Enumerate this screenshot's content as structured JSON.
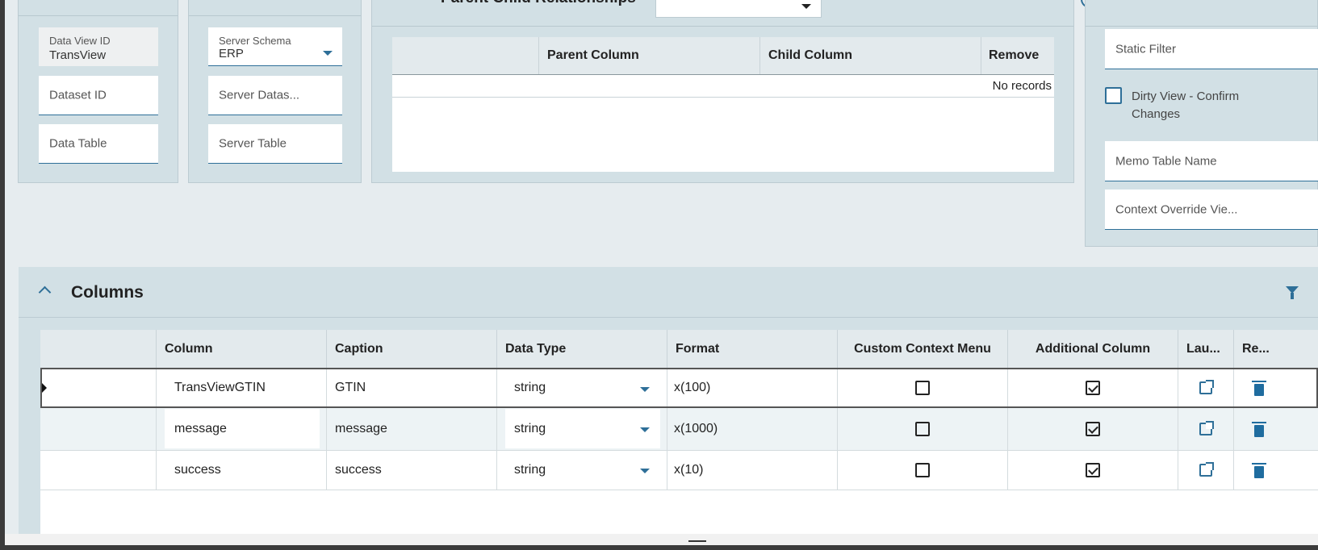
{
  "dataset_panel": {
    "data_view_id": {
      "label": "Data View ID",
      "value": "TransView"
    },
    "dataset_id": {
      "placeholder": "Dataset ID"
    },
    "data_table": {
      "placeholder": "Data Table"
    }
  },
  "server_panel": {
    "server_schema": {
      "label": "Server Schema",
      "value": "ERP"
    },
    "server_dataset": {
      "placeholder": "Server Datas..."
    },
    "server_table": {
      "placeholder": "Server Table"
    }
  },
  "relationships": {
    "title": "Parent Child Relationships",
    "headers": [
      "",
      "Parent Column",
      "Child Column",
      "Remove"
    ],
    "empty_text": "No records"
  },
  "options_panel": {
    "static_filter": {
      "placeholder": "Static Filter"
    },
    "dirty_view": {
      "label": "Dirty View - Confirm Changes",
      "checked": false
    },
    "memo_table": {
      "placeholder": "Memo Table Name"
    },
    "context_override": {
      "placeholder": "Context Override Vie..."
    }
  },
  "columns_section": {
    "title": "Columns",
    "headers": [
      "",
      "Column",
      "Caption",
      "Data Type",
      "Format",
      "Custom Context Menu",
      "Additional Column",
      "Lau...",
      "Re..."
    ],
    "rows": [
      {
        "column": "TransViewGTIN",
        "caption": "GTIN",
        "data_type": "string",
        "format": "x(100)",
        "custom_context_menu": false,
        "additional_column": true
      },
      {
        "column": "message",
        "caption": "message",
        "data_type": "string",
        "format": "x(1000)",
        "custom_context_menu": false,
        "additional_column": true
      },
      {
        "column": "success",
        "caption": "success",
        "data_type": "string",
        "format": "x(10)",
        "custom_context_menu": false,
        "additional_column": true
      }
    ]
  },
  "icons": {
    "collapse": "chevron-up-icon",
    "filter": "filter-icon",
    "info": "info-icon",
    "launch": "external-link-icon",
    "remove": "trash-icon"
  },
  "colors": {
    "accent": "#2e6f98",
    "panel": "#d2e0e5",
    "header": "#e3eaed"
  }
}
